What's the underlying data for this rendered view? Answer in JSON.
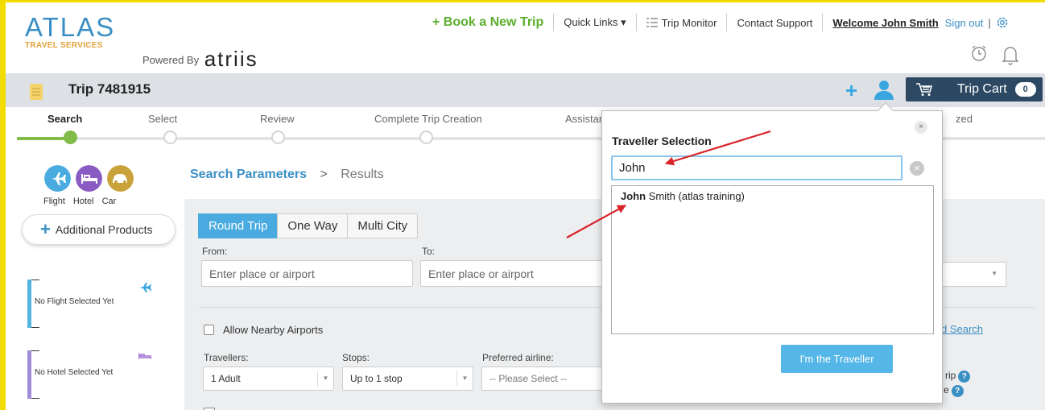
{
  "brand": {
    "logo_title": "ATLAS",
    "logo_subtitle": "TRAVEL SERVICES",
    "powered_by_label": "Powered By",
    "powered_by_brand": "atriis"
  },
  "topnav": {
    "book_new_trip": "+ Book a New Trip",
    "quick_links": "Quick Links ▾",
    "trip_monitor": "Trip Monitor",
    "contact_support": "Contact Support",
    "welcome": "Welcome John Smith",
    "sign_out": "Sign out",
    "pipe": "|"
  },
  "tripbar": {
    "title": "Trip 7481915",
    "add_symbol": "+",
    "cart_label": "Trip Cart",
    "cart_count": "0"
  },
  "steps": [
    {
      "label": "Search"
    },
    {
      "label": "Select"
    },
    {
      "label": "Review"
    },
    {
      "label": "Complete Trip Creation"
    },
    {
      "label": "Assistar"
    },
    {
      "label": "zed"
    }
  ],
  "products": {
    "flight": "Flight",
    "hotel": "Hotel",
    "car": "Car",
    "additional": "Additional Products"
  },
  "selections": {
    "flight": "No Flight Selected Yet",
    "hotel": "No Hotel Selected Yet"
  },
  "search": {
    "breadcrumb_active": "Search Parameters",
    "breadcrumb_sep": ">",
    "breadcrumb_next": "Results",
    "trip_types": [
      "Round Trip",
      "One Way",
      "Multi City"
    ],
    "from_label": "From:",
    "from_placeholder": "Enter place or airport",
    "to_label": "To:",
    "to_placeholder": "Enter place or airport",
    "allow_nearby": "Allow Nearby Airports",
    "advanced_search": "d Search",
    "travellers_label": "Travellers:",
    "travellers_value": "1 Adult",
    "stops_label": "Stops:",
    "stops_value": "Up to 1 stop",
    "airline_label": "Preferred airline:",
    "airline_value": "-- Please Select --",
    "partial_trip": "rip",
    "partial_e": "e",
    "help": "?"
  },
  "popup": {
    "title": "Traveller Selection",
    "close": "×",
    "search_value": "John",
    "clear": "×",
    "results": [
      {
        "match": "John",
        "rest": " Smith (atlas training)"
      }
    ],
    "button": "I'm the Traveller"
  },
  "colors": {
    "accent_blue": "#3a8fc4",
    "book_green": "#5cae2e",
    "progress_green": "#82bc48",
    "cart_navy": "#2c4862",
    "flight_blue": "#4aabe0",
    "hotel_purple": "#8a5bc2",
    "car_gold": "#c9a23a",
    "arrow_red": "#d8242a",
    "frame_yellow": "#f2dc00"
  }
}
